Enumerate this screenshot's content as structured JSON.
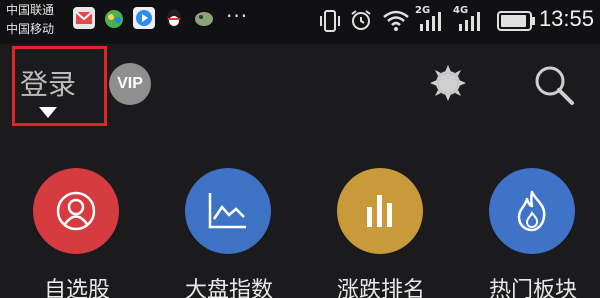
{
  "status_bar": {
    "carrier_1": "中国联通",
    "carrier_2": "中国移动",
    "network_tag_1": "2G",
    "network_tag_2": "4G",
    "time": "13:55",
    "notification_icons": [
      "mail-icon",
      "game-icon",
      "video-icon",
      "qq-icon",
      "app-icon"
    ],
    "more_dots": "···"
  },
  "header": {
    "login_label": "登录",
    "vip_label": "VIP"
  },
  "menu": {
    "items": [
      {
        "label": "自选股",
        "icon": "user-circle-icon",
        "color": "#d63b3f"
      },
      {
        "label": "大盘指数",
        "icon": "line-chart-icon",
        "color": "#3d72c4"
      },
      {
        "label": "涨跌排名",
        "icon": "bar-chart-icon",
        "color": "#c89a3a"
      },
      {
        "label": "热门板块",
        "icon": "flame-icon",
        "color": "#3e73c8"
      }
    ]
  },
  "colors": {
    "background": "#1b1b1d",
    "highlight_border": "#e0262a"
  }
}
